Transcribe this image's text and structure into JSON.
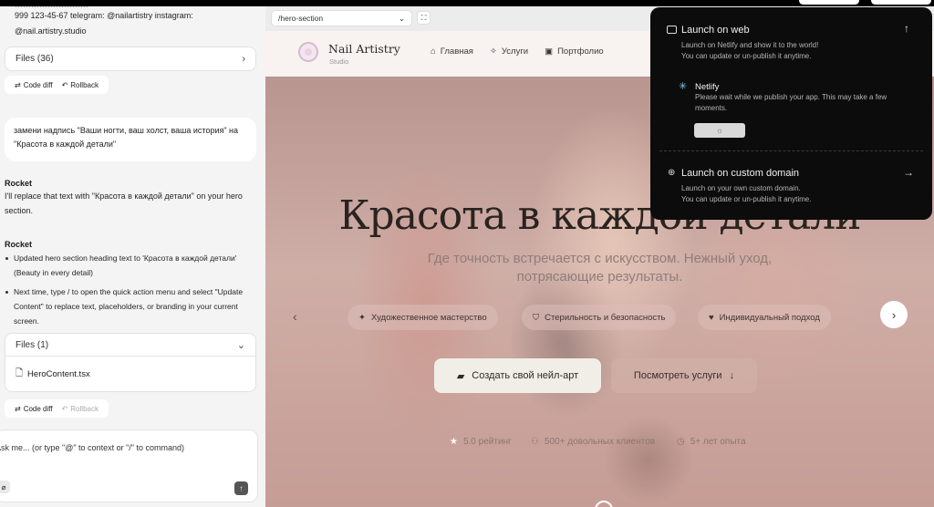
{
  "left": {
    "intro_line1": "999 123-45-67 telegram: @nailartistry instagram:",
    "intro_line2": "@nail.artistry.studio",
    "files_top_label": "Files (36)",
    "code_diff_label": "Code diff",
    "rollback_label": "Rollback",
    "user_message": "замени надпись \"Ваши ногти, ваш холст, ваша история\" на \"Красота в каждой детали\"",
    "assistant_name_1": "Rocket",
    "assistant_text_1": "I'll replace that text with \"Красота в каждой детали\" on your hero section.",
    "assistant_name_2": "Rocket",
    "bullets": [
      "Updated hero section heading text to 'Красота в каждой детали' (Beauty in every detail)",
      "Next time, type / to open the quick action menu and select \"Update Content\" to replace text, placeholders, or branding in your current screen."
    ],
    "files_bottom_label": "Files (1)",
    "file_name": "HeroContent.tsx",
    "code_diff_label_2": "Code diff",
    "rollback_label_2": "Rollback",
    "input_placeholder": "Ask me... (or type \"@\" to context or \"/\" to command)"
  },
  "preview": {
    "url": "/hero-section",
    "brand": "Nail Artistry",
    "brand_sub": "Studio",
    "nav": [
      "Главная",
      "Услуги",
      "Портфолио"
    ],
    "hero_title": "Красота в каждой детали",
    "hero_sub": "Где точность встречается с искусством. Нежный уход, потрясающие результаты.",
    "features": [
      "Художественное мастерство",
      "Стерильность и безопасность",
      "Индивидуальный подход"
    ],
    "cta_primary": "Создать свой нейл-арт",
    "cta_secondary": "Посмотреть услуги",
    "stats": [
      "5.0 рейтинг",
      "500+ довольных клиентов",
      "5+ лет опыта"
    ]
  },
  "popup": {
    "web_title": "Launch on web",
    "web_desc_1": "Launch on Netlify and show it to the world!",
    "web_desc_2": "You can update or un-publish it anytime.",
    "netlify_title": "Netlify",
    "netlify_desc_1": "Please wait while we publish your app. This may take a few",
    "netlify_desc_2": "moments.",
    "domain_title": "Launch on custom domain",
    "domain_desc_1": "Launch on your own custom domain.",
    "domain_desc_2": "You can update or un-publish it anytime."
  },
  "icons": {
    "chevron_right": "chevron-right-icon",
    "chevron_down": "chevron-down-icon",
    "upload": "arrow-up-icon",
    "arrow_right": "arrow-right-icon"
  },
  "colors": {
    "popup_bg": "#0c0c0c",
    "hero_cta_bg": "#f0eee6",
    "panel_bg": "#f4f4f4"
  }
}
